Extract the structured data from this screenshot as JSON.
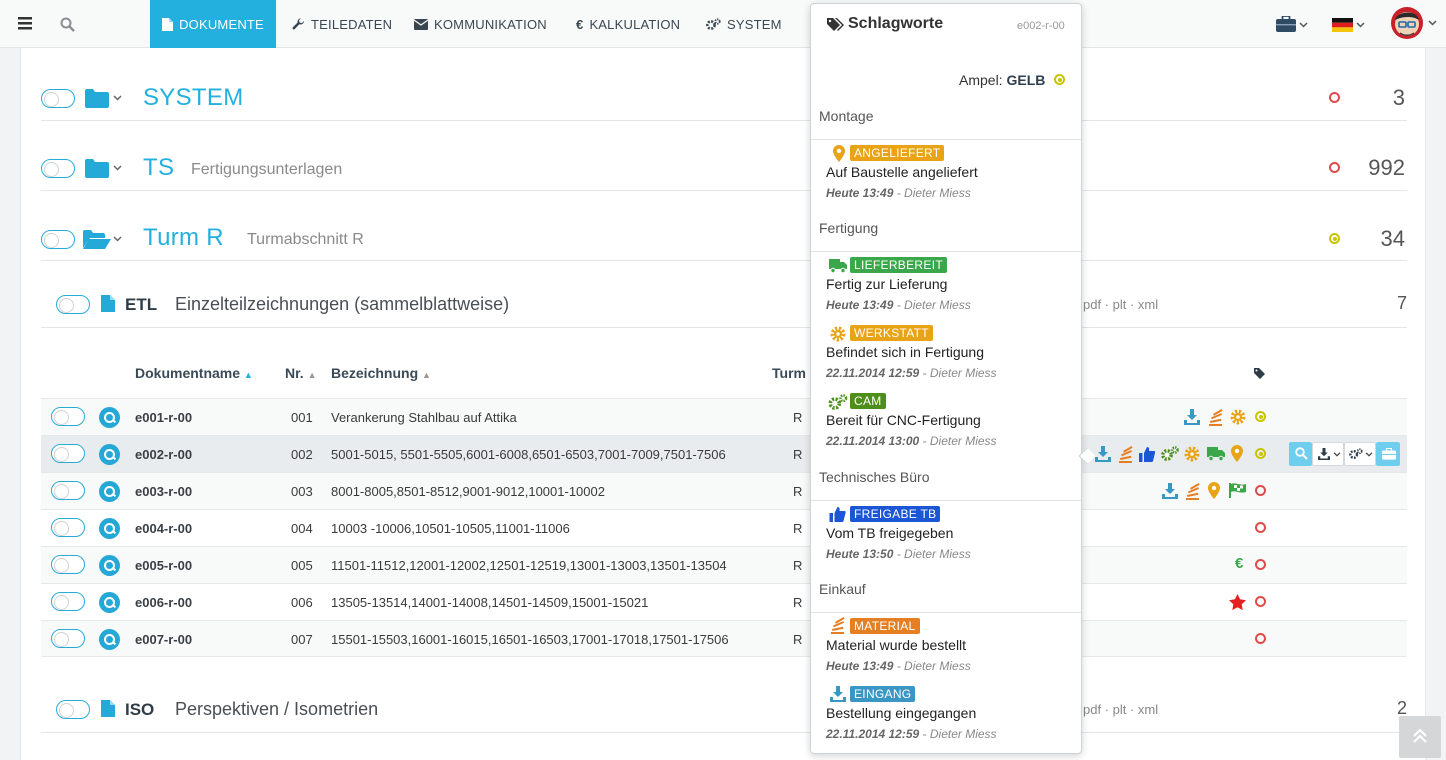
{
  "nav": {
    "tabs": [
      {
        "label": "DOKUMENTE",
        "icon": "file-icon",
        "active": true
      },
      {
        "label": "TEILEDATEN",
        "icon": "wrench-icon"
      },
      {
        "label": "KOMMUNIKATION",
        "icon": "envelope-icon"
      },
      {
        "label": "KALKULATION",
        "icon": "euro-icon"
      },
      {
        "label": "SYSTEM",
        "icon": "cogs-icon"
      }
    ]
  },
  "folders": [
    {
      "title": "SYSTEM",
      "subtitle": "",
      "count": "3",
      "status": "red"
    },
    {
      "title": "TS",
      "subtitle": "Fertigungsunterlagen",
      "count": "992",
      "status": "red"
    },
    {
      "title": "Turm R",
      "subtitle": "Turmabschnitt R",
      "count": "34",
      "status": "yellow"
    }
  ],
  "sections": [
    {
      "code": "ETL",
      "title": "Einzelteilzeichnungen (sammelblattweise)",
      "ext": "pdf · plt · xml",
      "count": "7"
    },
    {
      "code": "ISO",
      "title": "Perspektiven / Isometrien",
      "ext": "pdf · plt · xml",
      "count": "2"
    }
  ],
  "table": {
    "headers": {
      "name": "Dokumentname",
      "nr": "Nr.",
      "bez": "Bezeichnung",
      "turm": "Turm"
    },
    "rows": [
      {
        "name": "e001-r-00",
        "nr": "001",
        "bez": "Verankerung Stahlbau auf Attika",
        "turm": "R"
      },
      {
        "name": "e002-r-00",
        "nr": "002",
        "bez": "5001-5015, 5501-5505,6001-6008,6501-6503,7001-7009,7501-7506",
        "turm": "R"
      },
      {
        "name": "e003-r-00",
        "nr": "003",
        "bez": "8001-8005,8501-8512,9001-9012,10001-10002",
        "turm": "R"
      },
      {
        "name": "e004-r-00",
        "nr": "004",
        "bez": "10003 -10006,10501-10505,11001-11006",
        "turm": "R"
      },
      {
        "name": "e005-r-00",
        "nr": "005",
        "bez": "11501-11512,12001-12002,12501-12519,13001-13003,13501-13504",
        "turm": "R"
      },
      {
        "name": "e006-r-00",
        "nr": "006",
        "bez": "13505-13514,14001-14008,14501-14509,15001-15021",
        "turm": "R"
      },
      {
        "name": "e007-r-00",
        "nr": "007",
        "bez": "15501-15503,16001-16015,16501-16503,17001-17018,17501-17506",
        "turm": "R"
      }
    ]
  },
  "popover": {
    "title": "Schlagworte",
    "doc_id": "e002-r-00",
    "ampel_label": "Ampel:",
    "ampel_value": "GELB",
    "groups": [
      {
        "name": "Montage"
      },
      {
        "name": "Fertigung"
      },
      {
        "name": "Technisches Büro"
      },
      {
        "name": "Einkauf"
      }
    ],
    "entries": [
      {
        "tag": "ANGELIEFERT",
        "color": "#e8a317",
        "icon": "map-marker-icon",
        "text": "Auf Baustelle angeliefert",
        "when": "Heute 13:49",
        "who": " - Dieter Miess"
      },
      {
        "tag": "LIEFERBEREIT",
        "color": "#3aa84a",
        "icon": "truck-icon",
        "text": "Fertig zur Lieferung",
        "when": "Heute 13:49",
        "who": " - Dieter Miess"
      },
      {
        "tag": "WERKSTATT",
        "color": "#e8a317",
        "icon": "gear-icon",
        "text": "Befindet sich in Fertigung",
        "when": "22.11.2014 12:59",
        "who": " - Dieter Miess"
      },
      {
        "tag": "CAM",
        "color": "#4d8f18",
        "icon": "cogs-icon",
        "text": "Bereit für CNC-Fertigung",
        "when": "22.11.2014 13:00",
        "who": " - Dieter Miess"
      },
      {
        "tag": "FREIGABE TB",
        "color": "#1a56d6",
        "icon": "thumbs-up-icon",
        "text": "Vom TB freigegeben",
        "when": "Heute 13:50",
        "who": " - Dieter Miess"
      },
      {
        "tag": "MATERIAL",
        "color": "#e67e22",
        "icon": "stack-icon",
        "text": "Material wurde bestellt",
        "when": "Heute 13:49",
        "who": " - Dieter Miess"
      },
      {
        "tag": "EINGANG",
        "color": "#3a97c4",
        "icon": "download-icon",
        "text": "Bestellung eingegangen",
        "when": "22.11.2014 12:59",
        "who": " - Dieter Miess"
      }
    ]
  }
}
